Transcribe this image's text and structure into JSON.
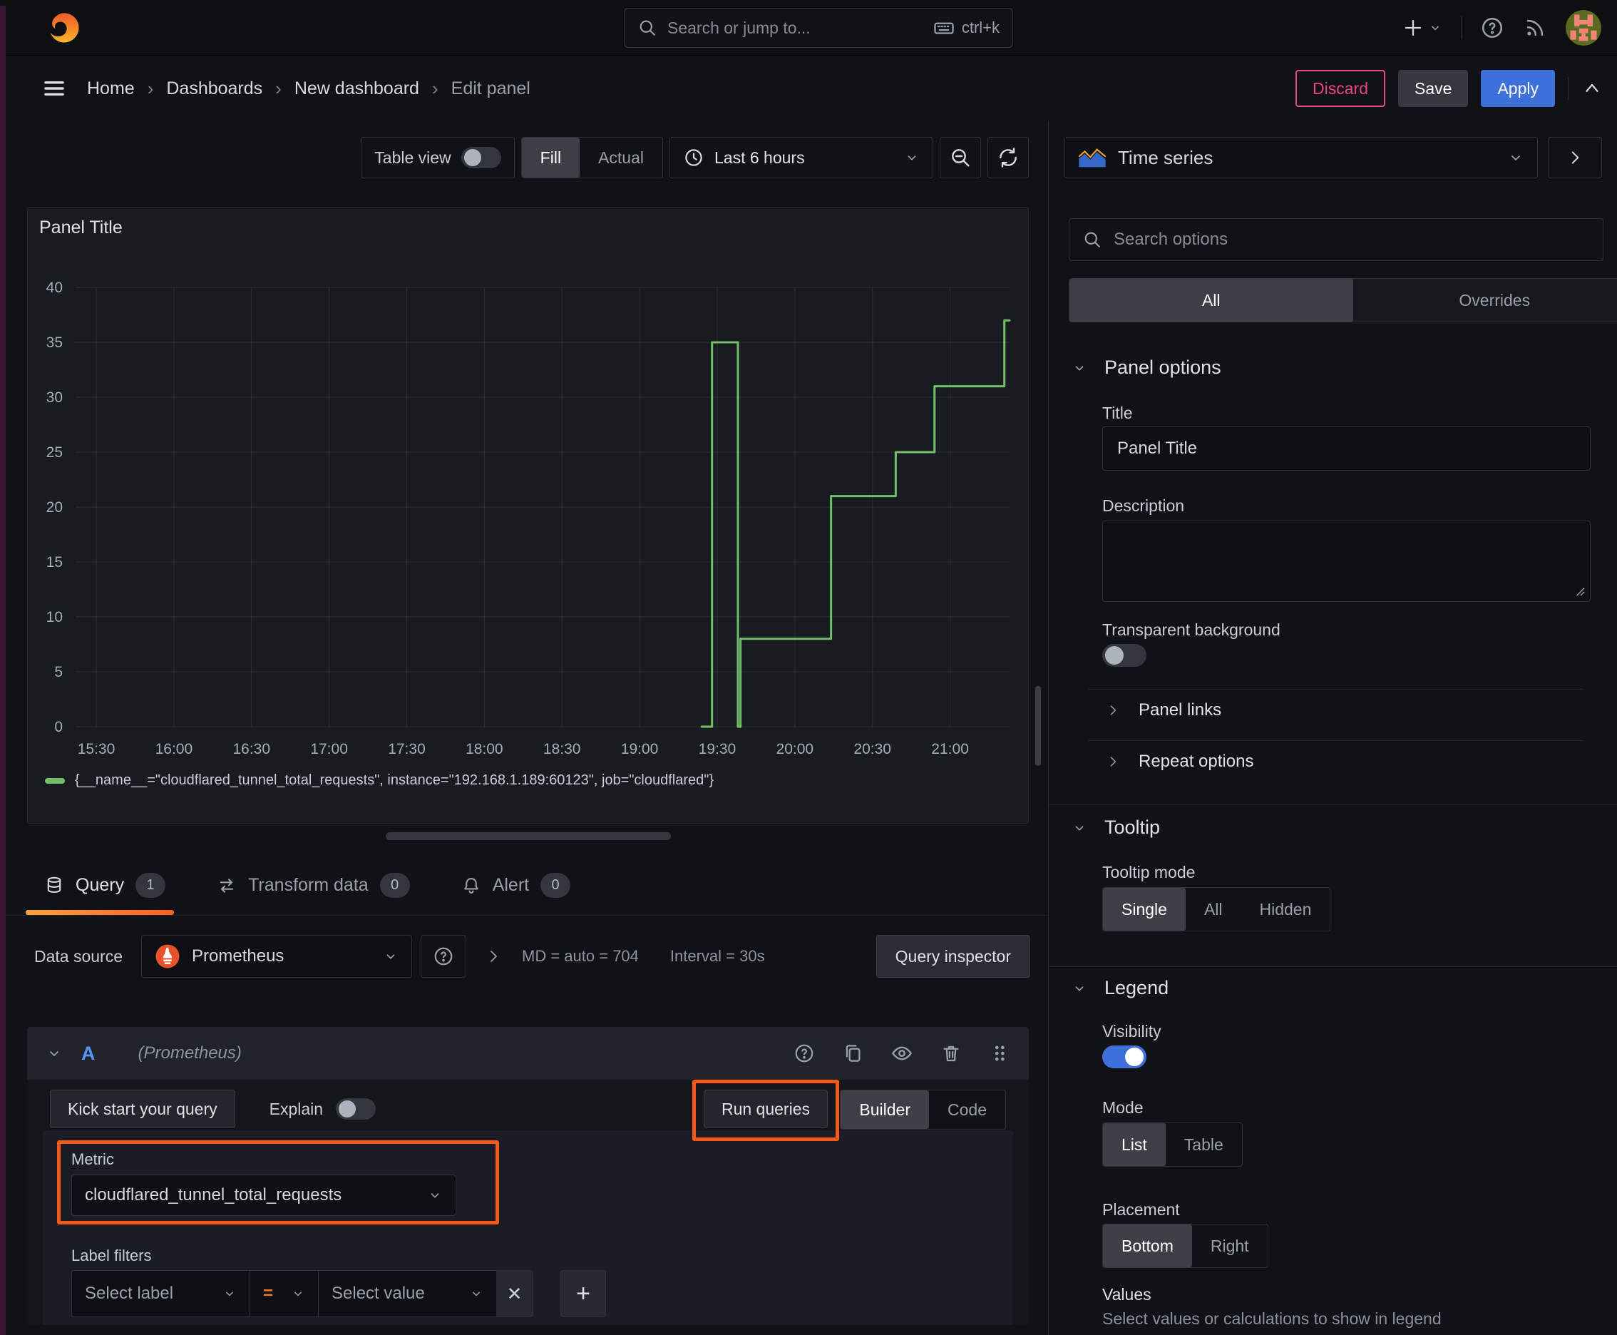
{
  "icons": {
    "plus": "+",
    "close": "✕",
    "question": "?",
    "breadcrumb_sep": "›"
  },
  "topnav": {
    "search": {
      "placeholder": "Search or jump to...",
      "shortcut": "ctrl+k"
    }
  },
  "breadcrumb": {
    "items": [
      "Home",
      "Dashboards",
      "New dashboard",
      "Edit panel"
    ],
    "actions": {
      "discard": "Discard",
      "save": "Save",
      "apply": "Apply"
    }
  },
  "toolbar": {
    "table_view_label": "Table view",
    "table_view_on": false,
    "fill_actual": {
      "options": [
        "Fill",
        "Actual"
      ],
      "active": "Fill"
    },
    "time_range": "Last 6 hours"
  },
  "panel": {
    "title": "Panel Title"
  },
  "chart_data": {
    "type": "line",
    "line_style": "step-after",
    "title": "Panel Title",
    "x_ticks": [
      "15:30",
      "16:00",
      "16:30",
      "17:00",
      "17:30",
      "18:00",
      "18:30",
      "19:00",
      "19:30",
      "20:00",
      "20:30",
      "21:00"
    ],
    "y_ticks": [
      0,
      5,
      10,
      15,
      20,
      25,
      30,
      35,
      40
    ],
    "x_range": [
      "15:22",
      "21:23"
    ],
    "ylim": [
      0,
      40
    ],
    "grid": true,
    "legend_position": "bottom",
    "series": [
      {
        "name": "{__name__=\"cloudflared_tunnel_total_requests\", instance=\"192.168.1.189:60123\", job=\"cloudflared\"}",
        "color": "#73bf69",
        "points": [
          [
            "19:24",
            0
          ],
          [
            "19:28",
            35
          ],
          [
            "19:38",
            0
          ],
          [
            "19:39",
            8
          ],
          [
            "20:14",
            21
          ],
          [
            "20:39",
            25
          ],
          [
            "20:54",
            31
          ],
          [
            "21:21",
            37
          ],
          [
            "21:23",
            37
          ]
        ]
      }
    ]
  },
  "tabs": {
    "query": {
      "label": "Query",
      "badge": "1"
    },
    "transform": {
      "label": "Transform data",
      "badge": "0"
    },
    "alert": {
      "label": "Alert",
      "badge": "0"
    }
  },
  "datasource_row": {
    "label": "Data source",
    "value": "Prometheus",
    "md_stat": "MD = auto = 704",
    "interval_stat": "Interval = 30s",
    "query_inspector": "Query inspector"
  },
  "query_editor": {
    "ref_id": "A",
    "ds_hint": "(Prometheus)",
    "kick_start": "Kick start your query",
    "explain_label": "Explain",
    "explain_on": false,
    "run_queries": "Run queries",
    "builder_code": {
      "options": [
        "Builder",
        "Code"
      ],
      "active": "Builder"
    },
    "metric_label": "Metric",
    "metric_value": "cloudflared_tunnel_total_requests",
    "label_filters_label": "Label filters",
    "select_label_placeholder": "Select label",
    "operator": "=",
    "select_value_placeholder": "Select value"
  },
  "options_pane": {
    "visualization": "Time series",
    "search_placeholder": "Search options",
    "scope": {
      "options": [
        "All",
        "Overrides"
      ],
      "active": "All"
    },
    "panel_options": {
      "header": "Panel options",
      "title_label": "Title",
      "title_value": "Panel Title",
      "description_label": "Description",
      "transparent_label": "Transparent background",
      "transparent_on": false
    },
    "panel_links_header": "Panel links",
    "repeat_options_header": "Repeat options",
    "tooltip": {
      "header": "Tooltip",
      "mode_label": "Tooltip mode",
      "mode": {
        "options": [
          "Single",
          "All",
          "Hidden"
        ],
        "active": "Single"
      }
    },
    "legend": {
      "header": "Legend",
      "visibility_label": "Visibility",
      "visibility_on": true,
      "mode_label": "Mode",
      "mode": {
        "options": [
          "List",
          "Table"
        ],
        "active": "List"
      },
      "placement_label": "Placement",
      "placement": {
        "options": [
          "Bottom",
          "Right"
        ],
        "active": "Bottom"
      },
      "values_label": "Values",
      "values_hint": "Select values or calculations to show in legend"
    }
  },
  "colors": {
    "accent_blue": "#3d71d9",
    "discard_pink": "#e5477e",
    "annotation_orange": "#f4591c",
    "series_green": "#73bf69",
    "tab_underline": "#ff780a",
    "prometheus_orange": "#e6522c"
  }
}
